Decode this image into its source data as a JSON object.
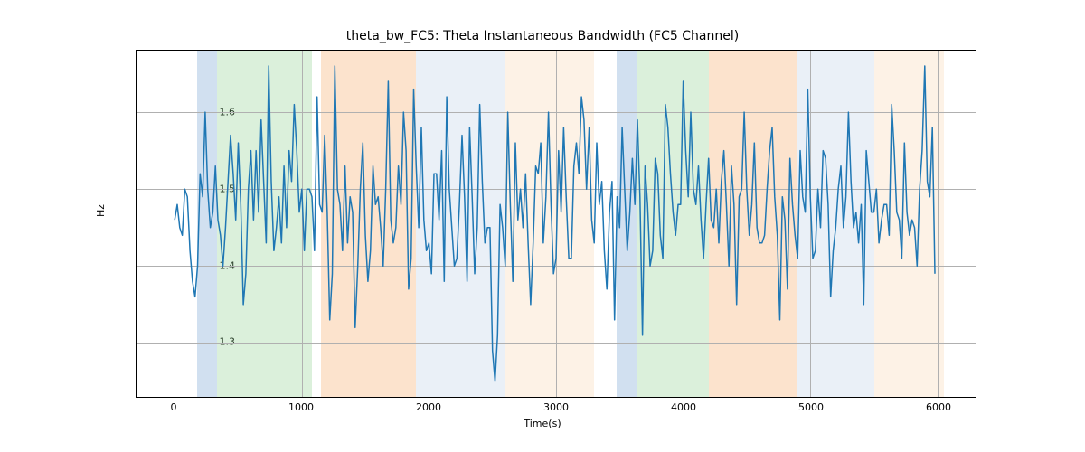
{
  "chart_data": {
    "type": "line",
    "title": "theta_bw_FC5: Theta Instantaneous Bandwidth (FC5 Channel)",
    "xlabel": "Time(s)",
    "ylabel": "Hz",
    "xlim": [
      -300,
      6300
    ],
    "ylim": [
      1.23,
      1.68
    ],
    "xticks": [
      0,
      1000,
      2000,
      3000,
      4000,
      5000,
      6000
    ],
    "yticks": [
      1.3,
      1.4,
      1.5,
      1.6
    ],
    "grid": true,
    "bands": [
      {
        "x0": 180,
        "x1": 330,
        "color": "#6699cc"
      },
      {
        "x0": 330,
        "x1": 1080,
        "color": "#88cc88"
      },
      {
        "x0": 1150,
        "x1": 1900,
        "color": "#f5a35b"
      },
      {
        "x0": 1900,
        "x1": 2600,
        "color": "#b8cde6"
      },
      {
        "x0": 2600,
        "x1": 3300,
        "color": "#f8d4ab"
      },
      {
        "x0": 3480,
        "x1": 3630,
        "color": "#6699cc"
      },
      {
        "x0": 3630,
        "x1": 4200,
        "color": "#88cc88"
      },
      {
        "x0": 4200,
        "x1": 4900,
        "color": "#f5a35b"
      },
      {
        "x0": 4900,
        "x1": 5500,
        "color": "#b8cde6"
      },
      {
        "x0": 5500,
        "x1": 6050,
        "color": "#f8d4ab"
      }
    ],
    "series": [
      {
        "name": "theta_bw_FC5",
        "color": "#1f77b4",
        "x_step": 20,
        "x_start": 0,
        "values": [
          1.46,
          1.48,
          1.45,
          1.44,
          1.5,
          1.49,
          1.42,
          1.38,
          1.36,
          1.4,
          1.52,
          1.49,
          1.6,
          1.5,
          1.45,
          1.47,
          1.53,
          1.46,
          1.44,
          1.4,
          1.45,
          1.51,
          1.57,
          1.52,
          1.46,
          1.56,
          1.48,
          1.35,
          1.39,
          1.5,
          1.55,
          1.46,
          1.55,
          1.47,
          1.59,
          1.51,
          1.43,
          1.66,
          1.51,
          1.42,
          1.45,
          1.49,
          1.43,
          1.53,
          1.45,
          1.55,
          1.51,
          1.61,
          1.55,
          1.47,
          1.5,
          1.42,
          1.5,
          1.5,
          1.49,
          1.42,
          1.62,
          1.48,
          1.47,
          1.57,
          1.47,
          1.33,
          1.39,
          1.66,
          1.5,
          1.48,
          1.42,
          1.53,
          1.43,
          1.49,
          1.47,
          1.32,
          1.4,
          1.5,
          1.56,
          1.44,
          1.38,
          1.42,
          1.53,
          1.48,
          1.49,
          1.45,
          1.4,
          1.5,
          1.64,
          1.46,
          1.43,
          1.45,
          1.53,
          1.48,
          1.6,
          1.55,
          1.37,
          1.41,
          1.63,
          1.53,
          1.45,
          1.58,
          1.46,
          1.42,
          1.43,
          1.39,
          1.52,
          1.52,
          1.46,
          1.55,
          1.38,
          1.62,
          1.5,
          1.45,
          1.4,
          1.41,
          1.48,
          1.57,
          1.49,
          1.38,
          1.58,
          1.49,
          1.39,
          1.45,
          1.61,
          1.51,
          1.43,
          1.45,
          1.45,
          1.29,
          1.25,
          1.31,
          1.48,
          1.45,
          1.4,
          1.6,
          1.48,
          1.38,
          1.56,
          1.46,
          1.5,
          1.45,
          1.52,
          1.43,
          1.35,
          1.43,
          1.53,
          1.52,
          1.56,
          1.43,
          1.49,
          1.6,
          1.48,
          1.39,
          1.41,
          1.55,
          1.47,
          1.58,
          1.49,
          1.41,
          1.41,
          1.53,
          1.56,
          1.52,
          1.62,
          1.59,
          1.5,
          1.58,
          1.46,
          1.43,
          1.56,
          1.48,
          1.51,
          1.42,
          1.37,
          1.47,
          1.51,
          1.33,
          1.49,
          1.45,
          1.58,
          1.5,
          1.42,
          1.47,
          1.54,
          1.48,
          1.59,
          1.49,
          1.31,
          1.53,
          1.48,
          1.4,
          1.42,
          1.54,
          1.52,
          1.44,
          1.41,
          1.61,
          1.58,
          1.52,
          1.47,
          1.44,
          1.48,
          1.48,
          1.64,
          1.55,
          1.49,
          1.6,
          1.5,
          1.48,
          1.53,
          1.46,
          1.41,
          1.48,
          1.54,
          1.46,
          1.45,
          1.5,
          1.43,
          1.51,
          1.55,
          1.48,
          1.4,
          1.53,
          1.48,
          1.35,
          1.49,
          1.5,
          1.6,
          1.5,
          1.44,
          1.48,
          1.56,
          1.45,
          1.43,
          1.43,
          1.44,
          1.5,
          1.55,
          1.58,
          1.49,
          1.44,
          1.33,
          1.49,
          1.46,
          1.37,
          1.54,
          1.48,
          1.44,
          1.41,
          1.55,
          1.49,
          1.47,
          1.63,
          1.49,
          1.41,
          1.42,
          1.5,
          1.45,
          1.55,
          1.54,
          1.48,
          1.36,
          1.42,
          1.45,
          1.5,
          1.53,
          1.45,
          1.49,
          1.6,
          1.51,
          1.45,
          1.47,
          1.43,
          1.48,
          1.35,
          1.55,
          1.51,
          1.47,
          1.47,
          1.5,
          1.43,
          1.46,
          1.48,
          1.48,
          1.44,
          1.61,
          1.55,
          1.47,
          1.46,
          1.41,
          1.56,
          1.47,
          1.44,
          1.46,
          1.45,
          1.4,
          1.5,
          1.55,
          1.66,
          1.51,
          1.49,
          1.58,
          1.39
        ]
      }
    ]
  }
}
